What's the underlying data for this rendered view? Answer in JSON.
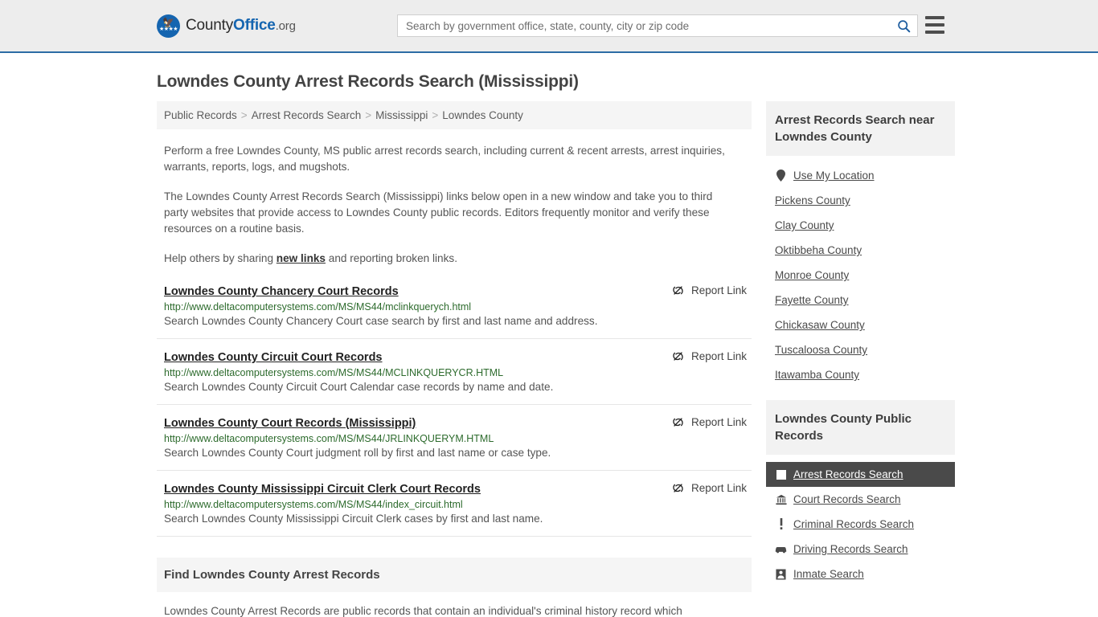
{
  "header": {
    "brand": {
      "part1": "County",
      "part2": "Office",
      "tld": ".org",
      "logo_icon": "eagle-seal-icon"
    },
    "search": {
      "value": "",
      "placeholder": "Search by government office, state, county, city or zip code",
      "icon": "search-icon"
    },
    "menu_icon": "hamburger-menu-icon"
  },
  "page": {
    "title": "Lowndes County Arrest Records Search (Mississippi)"
  },
  "breadcrumb": {
    "items": [
      {
        "label": "Public Records"
      },
      {
        "label": "Arrest Records Search"
      },
      {
        "label": "Mississippi"
      },
      {
        "label": "Lowndes County"
      }
    ],
    "separator": ">"
  },
  "intro": {
    "p1": "Perform a free Lowndes County, MS public arrest records search, including current & recent arrests, arrest inquiries, warrants, reports, logs, and mugshots.",
    "p2": "The Lowndes County Arrest Records Search (Mississippi) links below open in a new window and take you to third party websites that provide access to Lowndes County public records. Editors frequently monitor and verify these resources on a routine basis.",
    "p3_before": "Help others by sharing ",
    "p3_link": "new links",
    "p3_after": " and reporting broken links."
  },
  "results": {
    "report_label": "Report Link",
    "report_icon": "broken-link-icon",
    "items": [
      {
        "title": "Lowndes County Chancery Court Records",
        "url": "http://www.deltacomputersystems.com/MS/MS44/mclinkquerych.html",
        "description": "Search Lowndes County Chancery Court case search by first and last name and address."
      },
      {
        "title": "Lowndes County Circuit Court Records",
        "url": "http://www.deltacomputersystems.com/MS/MS44/MCLINKQUERYCR.HTML",
        "description": "Search Lowndes County Circuit Court Calendar case records by name and date."
      },
      {
        "title": "Lowndes County Court Records (Mississippi)",
        "url": "http://www.deltacomputersystems.com/MS/MS44/JRLINKQUERYM.HTML",
        "description": "Search Lowndes County Court judgment roll by first and last name or case type."
      },
      {
        "title": "Lowndes County Mississippi Circuit Clerk Court Records",
        "url": "http://www.deltacomputersystems.com/MS/MS44/index_circuit.html",
        "description": "Search Lowndes County Mississippi Circuit Clerk cases by first and last name."
      }
    ]
  },
  "find_section": {
    "heading": "Find Lowndes County Arrest Records",
    "body": "Lowndes County Arrest Records are public records that contain an individual's criminal history record which"
  },
  "sidebar": {
    "near": {
      "heading": "Arrest Records Search near Lowndes County",
      "items": [
        {
          "label": "Use My Location",
          "icon": "map-pin-icon"
        },
        {
          "label": "Pickens County",
          "icon": ""
        },
        {
          "label": "Clay County",
          "icon": ""
        },
        {
          "label": "Oktibbeha County",
          "icon": ""
        },
        {
          "label": "Monroe County",
          "icon": ""
        },
        {
          "label": "Fayette County",
          "icon": ""
        },
        {
          "label": "Chickasaw County",
          "icon": ""
        },
        {
          "label": "Tuscaloosa County",
          "icon": ""
        },
        {
          "label": "Itawamba County",
          "icon": ""
        }
      ]
    },
    "public_records": {
      "heading": "Lowndes County Public Records",
      "items": [
        {
          "label": "Arrest Records Search",
          "icon": "square-icon",
          "active": true
        },
        {
          "label": "Court Records Search",
          "icon": "courthouse-icon",
          "active": false
        },
        {
          "label": "Criminal Records Search",
          "icon": "exclamation-icon",
          "active": false
        },
        {
          "label": "Driving Records Search",
          "icon": "car-icon",
          "active": false
        },
        {
          "label": "Inmate Search",
          "icon": "inmate-icon",
          "active": false
        }
      ]
    }
  }
}
